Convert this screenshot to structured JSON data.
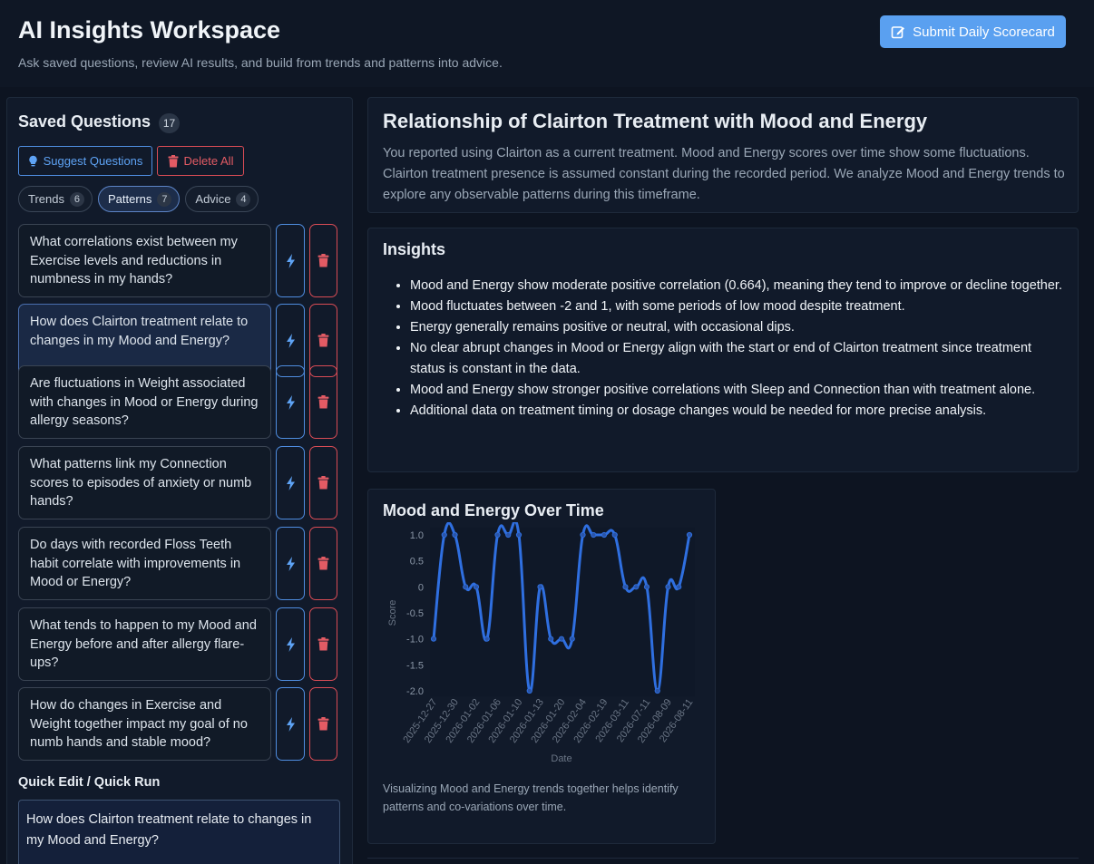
{
  "header": {
    "title": "AI Insights Workspace",
    "subtitle": "Ask saved questions, review AI results, and build from trends and patterns into advice.",
    "submit_label": "Submit Daily Scorecard",
    "accent_color": "#5aa0f0"
  },
  "sidebar": {
    "title": "Saved Questions",
    "count": "17",
    "suggest_label": "Suggest Questions",
    "delete_all_label": "Delete All",
    "tabs": [
      {
        "label": "Trends",
        "count": "6"
      },
      {
        "label": "Patterns",
        "count": "7",
        "active": true
      },
      {
        "label": "Advice",
        "count": "4"
      }
    ],
    "questions": [
      {
        "text": "What correlations exist between my Exercise levels and reductions in numbness in my hands?"
      },
      {
        "text": "How does Clairton treatment relate to changes in my Mood and Energy?",
        "selected": true
      },
      {
        "text": "Are fluctuations in Weight associated with changes in Mood or Energy during allergy seasons?"
      },
      {
        "text": "What patterns link my Connection scores to episodes of anxiety or numb hands?"
      },
      {
        "text": "Do days with recorded Floss Teeth habit correlate with improvements in Mood or Energy?"
      },
      {
        "text": "What tends to happen to my Mood and Energy before and after allergy flare-ups?"
      },
      {
        "text": "How do changes in Exercise and Weight together impact my goal of no numb hands and stable mood?"
      }
    ],
    "quick_title": "Quick Edit / Quick Run",
    "quick_value": "How does Clairton treatment relate to changes in my Mood and Energy?"
  },
  "main": {
    "title": "Relationship of Clairton Treatment with Mood and Energy",
    "summary": "You reported using Clairton as a current treatment. Mood and Energy scores over time show some fluctuations. Clairton treatment presence is assumed constant during the recorded period. We analyze Mood and Energy trends to explore any observable patterns during this timeframe.",
    "insights_title": "Insights",
    "insights": [
      "Mood and Energy show moderate positive correlation (0.664), meaning they tend to improve or decline together.",
      "Mood fluctuates between -2 and 1, with some periods of low mood despite treatment.",
      "Energy generally remains positive or neutral, with occasional dips.",
      "No clear abrupt changes in Mood or Energy align with the start or end of Clairton treatment since treatment status is constant in the data.",
      "Mood and Energy show stronger positive correlations with Sleep and Connection than with treatment alone.",
      "Additional data on treatment timing or dosage changes would be needed for more precise analysis."
    ],
    "chart_title": "Mood and Energy Over Time",
    "chart_caption": "Visualizing Mood and Energy trends together helps identify patterns and co-variations over time."
  },
  "chart_data": {
    "type": "line",
    "title": "Mood and Energy Over Time",
    "xlabel": "Date",
    "ylabel": "Score",
    "ylim": [
      -2.0,
      1.0
    ],
    "yticks": [
      1.0,
      0.5,
      0,
      -0.5,
      -1.0,
      -1.5,
      -2.0
    ],
    "x_tick_labels": [
      "2025-12-27",
      "2025-12-30",
      "2026-01-02",
      "2026-01-06",
      "2026-01-10",
      "2026-01-13",
      "2026-01-20",
      "2026-02-04",
      "2026-02-19",
      "2026-03-11",
      "2026-07-11",
      "2026-08-09",
      "2026-08-11"
    ],
    "series": [
      {
        "color": "#2f6fe0",
        "values": [
          -1,
          1,
          1,
          0,
          0,
          -1,
          1,
          1,
          1,
          -2,
          0,
          -1,
          -1,
          -1,
          1,
          1,
          1,
          1,
          0,
          0,
          0,
          -2,
          0,
          0,
          1
        ]
      }
    ],
    "grid": false,
    "legend": "none"
  }
}
